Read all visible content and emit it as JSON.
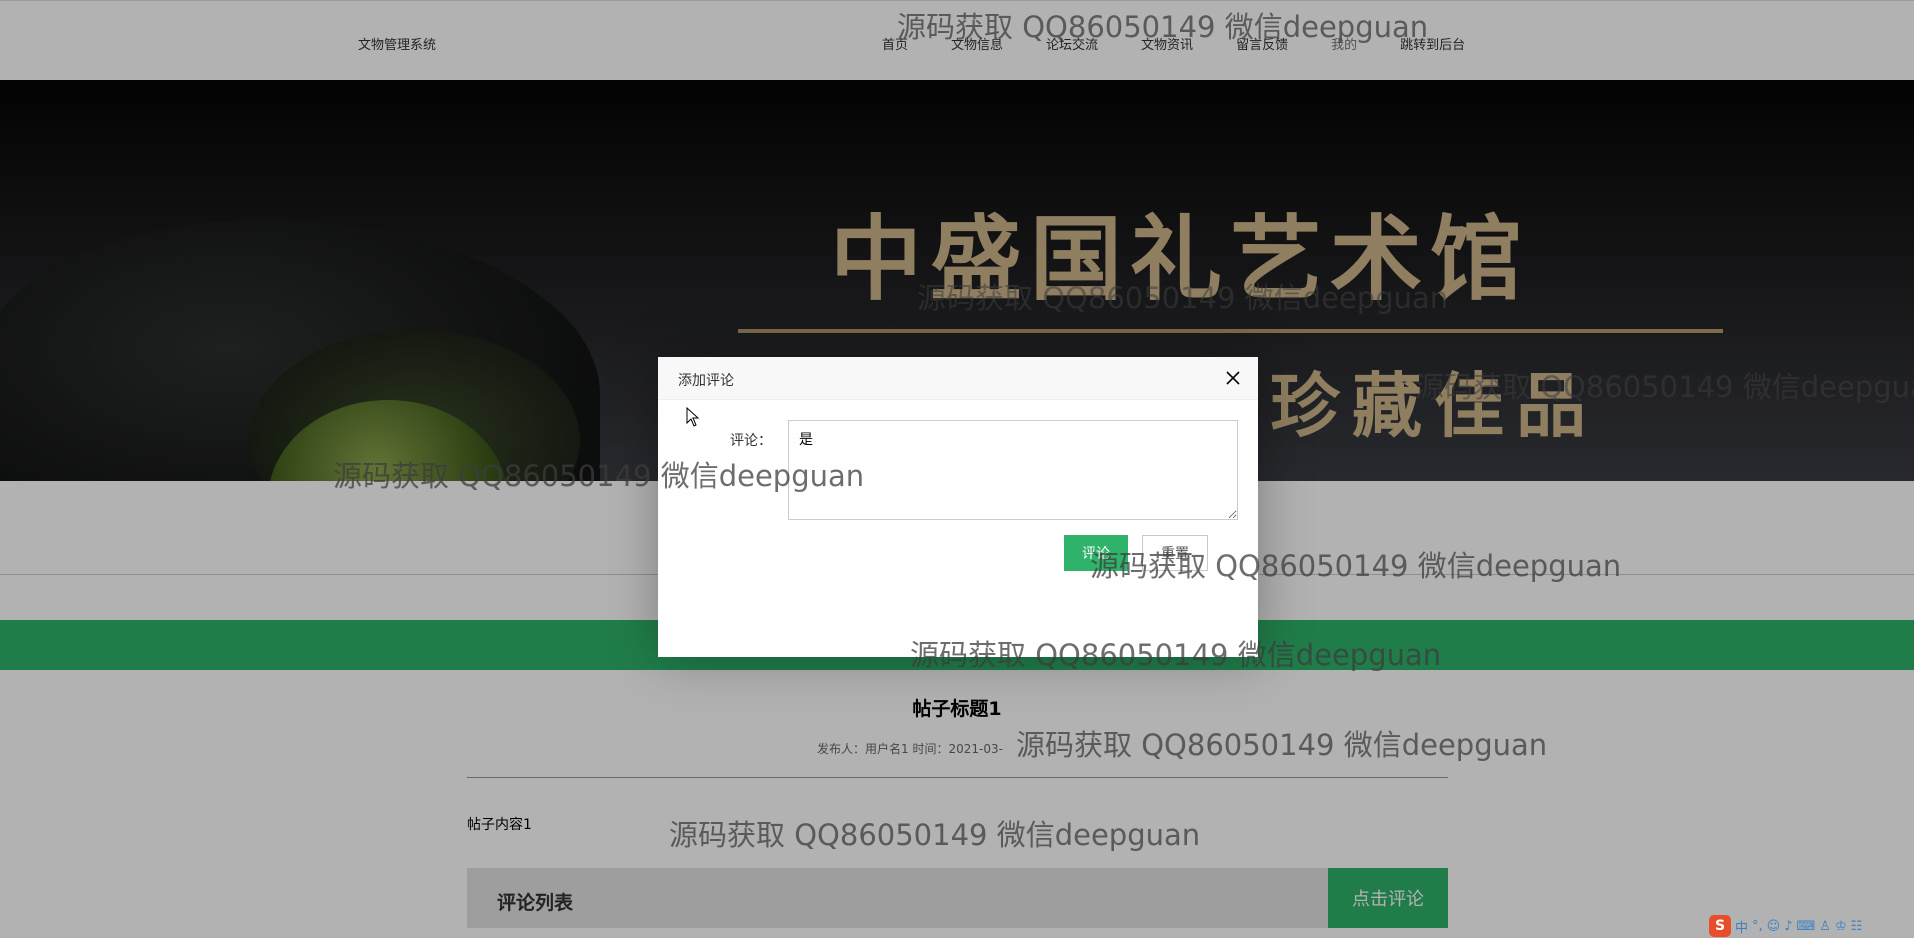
{
  "header": {
    "site_name": "文物管理系统",
    "nav": [
      "首页",
      "文物信息",
      "论坛交流",
      "文物资讯",
      "留言反馈",
      "我的",
      "跳转到后台"
    ]
  },
  "banner": {
    "title": "中盛国礼艺术馆",
    "subtitle": "珍藏佳品"
  },
  "post": {
    "title": "帖子标题1",
    "meta": "发布人：用户名1 时间：2021-03-",
    "content": "帖子内容1"
  },
  "comments": {
    "label": "评论列表",
    "button": "点击评论"
  },
  "dialog": {
    "title": "添加评论",
    "field_label": "评论：",
    "field_value": "是",
    "submit": "评论",
    "reset": "重置",
    "close_icon": "close-icon"
  },
  "watermark": "源码获取 QQ86050149 微信deepguan",
  "ime": {
    "icon": "sogou-icon",
    "text": "中"
  }
}
